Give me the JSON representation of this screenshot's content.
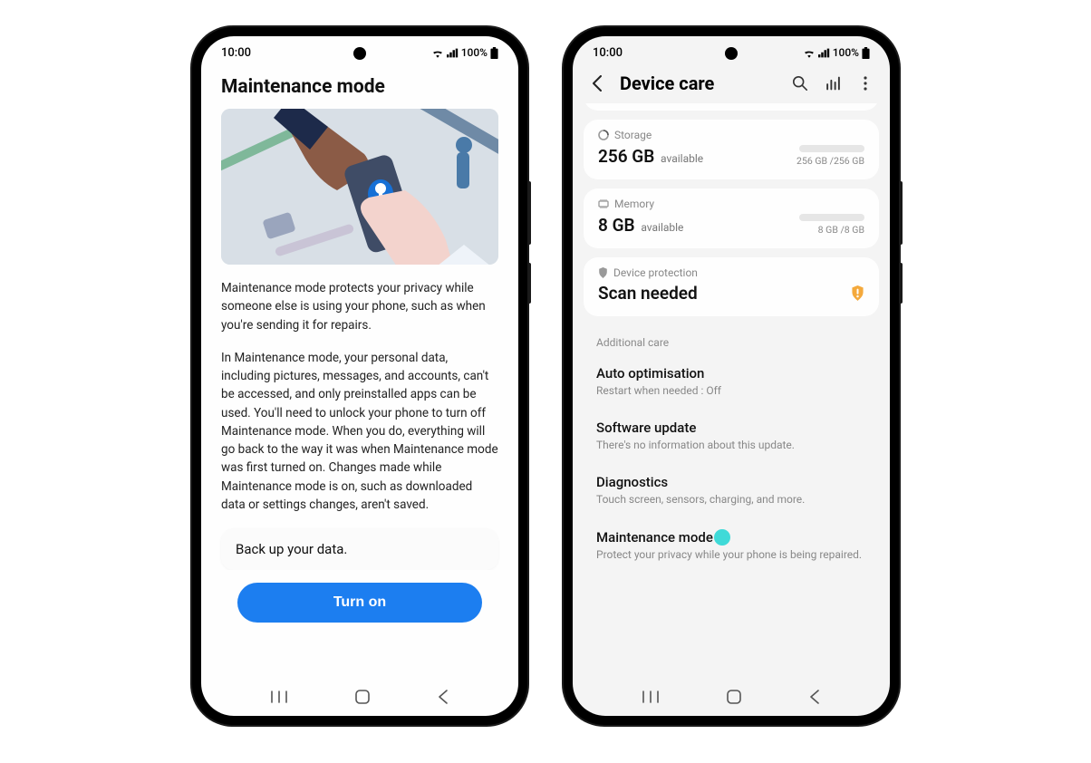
{
  "status": {
    "time": "10:00",
    "signal_text": "100%"
  },
  "phone1": {
    "title": "Maintenance mode",
    "para1": "Maintenance mode protects your privacy while someone else is using your phone, such as when you're sending it for repairs.",
    "para2": "In Maintenance mode, your personal data, including pictures, messages, and accounts, can't be accessed, and only preinstalled apps can be used. You'll need to unlock your phone to turn off Maintenance mode. When you do, everything will go back to the way it was when Maintenance mode was first turned on. Changes made while Maintenance mode is on, such as downloaded data or settings changes, aren't saved.",
    "backup": "Back up your data.",
    "turn_on": "Turn on"
  },
  "phone2": {
    "title": "Device care",
    "storage": {
      "label": "Storage",
      "value": "256 GB",
      "suffix": "available",
      "side": "256 GB /256 GB"
    },
    "memory": {
      "label": "Memory",
      "value": "8 GB",
      "suffix": "available",
      "side": "8 GB /8 GB"
    },
    "protection": {
      "label": "Device protection",
      "value": "Scan needed"
    },
    "section": "Additional care",
    "items": [
      {
        "title": "Auto optimisation",
        "sub": "Restart when needed : Off"
      },
      {
        "title": "Software update",
        "sub": "There's no information about this update."
      },
      {
        "title": "Diagnostics",
        "sub": "Touch screen, sensors, charging, and more."
      },
      {
        "title": "Maintenance mode",
        "sub": "Protect your privacy while your phone is being repaired."
      }
    ]
  }
}
